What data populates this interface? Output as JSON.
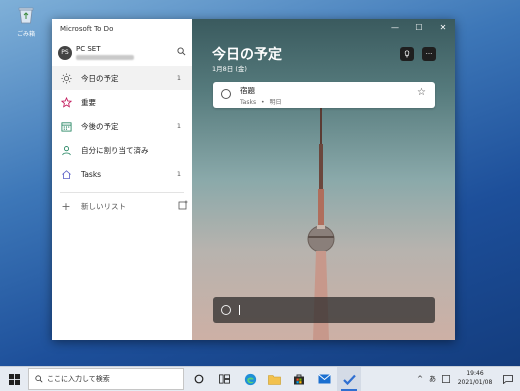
{
  "desktop": {
    "recycle_bin_label": "ごみ箱"
  },
  "app": {
    "title": "Microsoft To Do",
    "account": {
      "avatar_initials": "PS",
      "name": "PC SET"
    },
    "nav": [
      {
        "label": "今日の予定",
        "count": "1",
        "icon": "sun-icon"
      },
      {
        "label": "重要",
        "count": "",
        "icon": "star-icon"
      },
      {
        "label": "今後の予定",
        "count": "1",
        "icon": "calendar-icon"
      },
      {
        "label": "自分に割り当て済み",
        "count": "",
        "icon": "person-icon"
      },
      {
        "label": "Tasks",
        "count": "1",
        "icon": "home-icon"
      }
    ],
    "new_list_label": "新しいリスト"
  },
  "main": {
    "title": "今日の予定",
    "date": "1月8日 (金)",
    "task": {
      "title": "宿題",
      "list": "Tasks",
      "separator": "•",
      "due": "明日"
    }
  },
  "taskbar": {
    "search_placeholder": "ここに入力して検索",
    "ime": "あ",
    "clock_time": "19:46",
    "clock_date": "2021/01/08"
  },
  "colors": {
    "accent": "#2f6fd1",
    "window_close_hover": "#e81123"
  }
}
